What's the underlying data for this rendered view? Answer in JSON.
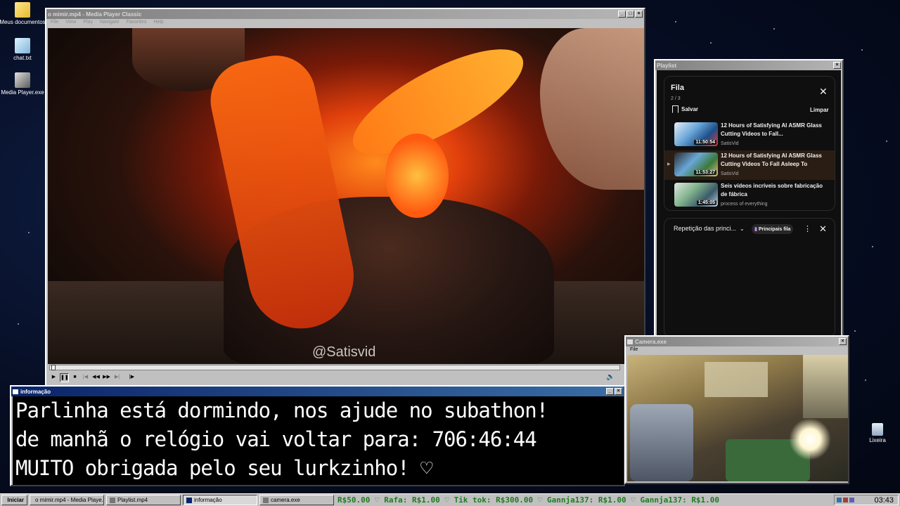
{
  "desktop": {
    "icons": [
      {
        "label": "Meus documentos",
        "icon": "folder-icon"
      },
      {
        "label": "chat.txt",
        "icon": "text-file-icon"
      },
      {
        "label": "Media Player.exe",
        "icon": "media-player-icon"
      },
      {
        "label": "Lixeira",
        "icon": "recycle-bin-icon"
      }
    ]
  },
  "mpc": {
    "title": "o mimir.mp4 - Media Player Classic",
    "menu": [
      "File",
      "View",
      "Play",
      "Navigate",
      "Favorites",
      "Help"
    ],
    "watermark": "@Satisvid",
    "controls": [
      "play-icon",
      "pause-icon",
      "stop-icon",
      "skip-back-icon",
      "rewind-icon",
      "forward-icon",
      "skip-forward-icon",
      "frame-step-icon"
    ]
  },
  "playlist": {
    "title": "Playlist",
    "queue_title": "Fila",
    "position": "2 / 3",
    "save_label": "Salvar",
    "clear_label": "Limpar",
    "items": [
      {
        "title": "12 Hours of Satisfying AI ASMR Glass Cutting Videos to Fall...",
        "channel": "SatisVid",
        "duration": "11:50:54"
      },
      {
        "title": "12 Hours of Satisfying AI ASMR Glass Cutting Videos To Fall Asleep To",
        "channel": "SatisVid",
        "duration": "11:53:27"
      },
      {
        "title": "Seis vídeos incríveis sobre fabricação de fábrica",
        "channel": "process of everything",
        "duration": "1:45:05"
      }
    ],
    "repeat_label": "Repetição das princi...",
    "badge_label": "Principais fila"
  },
  "info": {
    "title": "informação",
    "line1": "Parlinha está dormindo, nos ajude no subathon!",
    "line2_prefix": "de manhã o relógio vai voltar para:",
    "line2_time": "706:46:44",
    "line3": "MUITO obrigada pelo seu lurkzinho! ♡"
  },
  "camera": {
    "title": "Camera.exe",
    "menu_file": "File"
  },
  "taskbar": {
    "start": "Iniciar",
    "buttons": [
      "o mimir.mp4 - Media Playe...",
      "Playlist.mp4",
      "informação",
      "camera.exe"
    ],
    "ticker": "R$50.00 ♡  Rafa: R$1.00 ♡  Tik tok: R$300.00 ♡  Gannja137: R$1.00 ♡  Gannja137: R$1.00",
    "clock": "03:43"
  },
  "colors": {
    "titlebar_active": "#0a246a",
    "ticker_green": "#1f7a1f",
    "yt_background": "#0f0f0f"
  }
}
